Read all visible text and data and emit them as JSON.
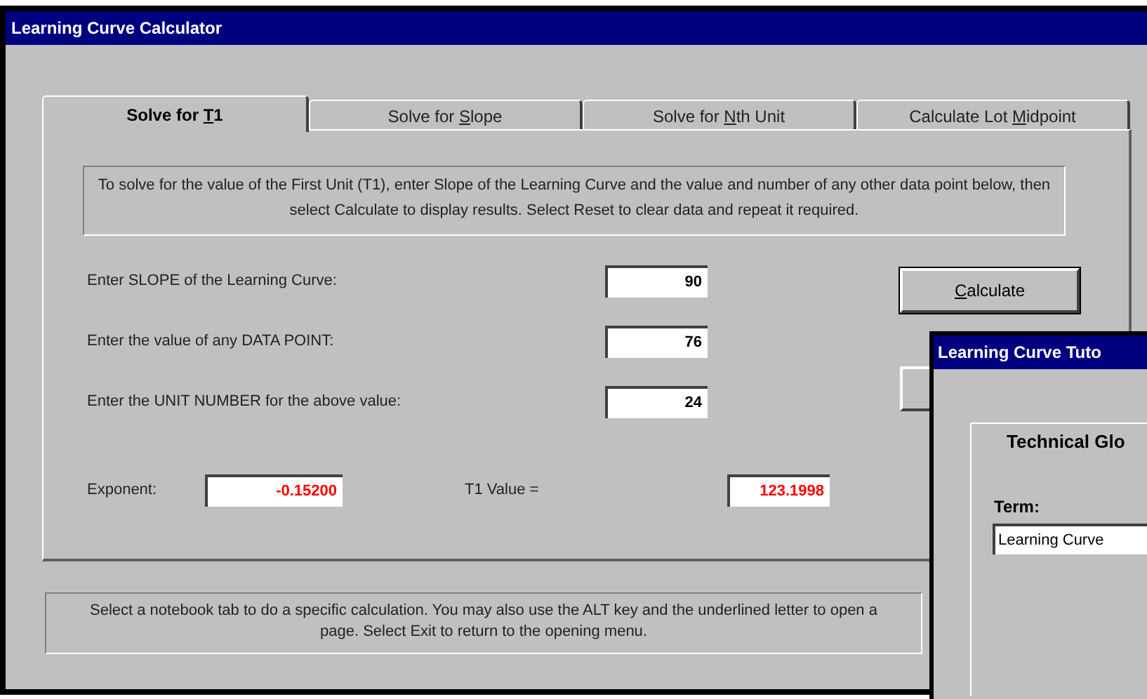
{
  "window": {
    "title": "Learning Curve Calculator"
  },
  "tabs": [
    {
      "before": "Solve for ",
      "hotkey": "T",
      "after": "1",
      "selected": true
    },
    {
      "before": "Solve for ",
      "hotkey": "S",
      "after": "lope",
      "selected": false
    },
    {
      "before": "Solve for ",
      "hotkey": "N",
      "after": "th Unit",
      "selected": false
    },
    {
      "before": "Calculate Lot ",
      "hotkey": "M",
      "after": "idpoint",
      "selected": false
    }
  ],
  "instructions": "To solve for the value of the First Unit (T1), enter Slope of the Learning Curve and the value and number of any other data point below, then select Calculate to display results. Select Reset to clear data and repeat it required.",
  "inputs": [
    {
      "label": "Enter SLOPE of the Learning Curve:",
      "value": "90"
    },
    {
      "label": "Enter the value of any DATA POINT:",
      "value": "76"
    },
    {
      "label": "Enter the UNIT NUMBER for the above value:",
      "value": "24"
    }
  ],
  "calculate_button": {
    "hotkey": "C",
    "after": "alculate"
  },
  "results": [
    {
      "label": "Exponent:",
      "value": "-0.15200"
    },
    {
      "label": "T1 Value =",
      "value": "123.1998"
    }
  ],
  "hint": "Select a notebook tab to do a specific calculation. You may also use the ALT key and the underlined letter to open a page. Select Exit to return to the opening menu.",
  "tutor_window": {
    "title": "Learning Curve Tuto",
    "tab": "Technical Glo",
    "term_label": "Term:",
    "term_value": "Learning Curve"
  }
}
